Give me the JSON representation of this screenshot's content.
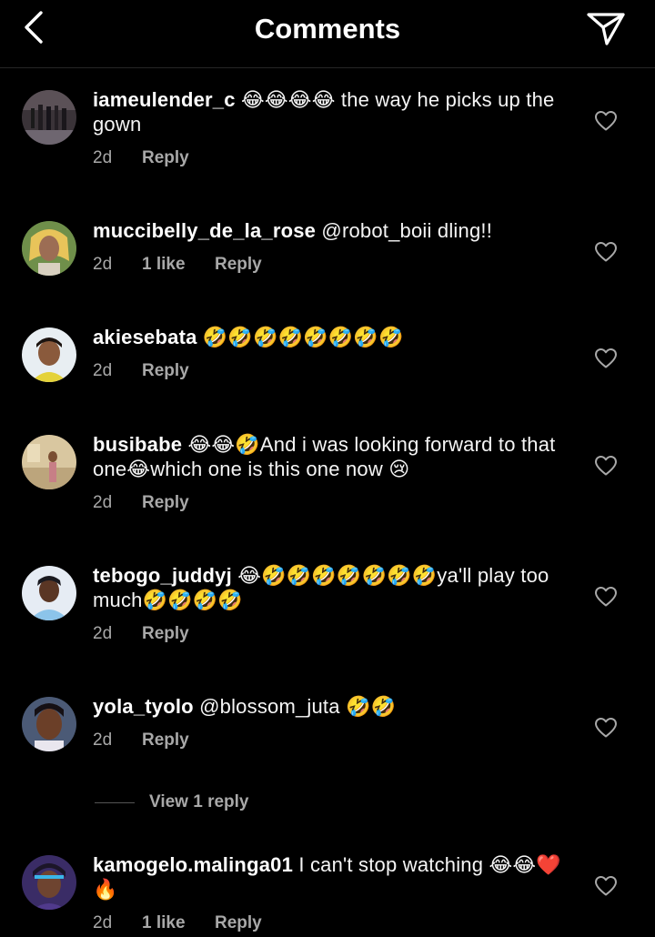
{
  "header": {
    "title": "Comments",
    "back_icon": "chevron-left-icon",
    "share_icon": "paper-plane-icon"
  },
  "comments": [
    {
      "username": "iameulender_c",
      "text": " 😂😂😂😂 the way he picks up the gown",
      "time": "2d",
      "likes": "",
      "reply_label": "Reply"
    },
    {
      "username": "muccibelly_de_la_rose",
      "text": " @robot_boii dling!!",
      "time": "2d",
      "likes": "1 like",
      "reply_label": "Reply"
    },
    {
      "username": "akiesebata",
      "text": " 🤣🤣🤣🤣🤣🤣🤣🤣",
      "time": "2d",
      "likes": "",
      "reply_label": "Reply"
    },
    {
      "username": "busibabe",
      "text": " 😂😂🤣And i was looking forward to that one😂which one is this one now 😢",
      "time": "2d",
      "likes": "",
      "reply_label": "Reply"
    },
    {
      "username": "tebogo_juddyj",
      "text": " 😂🤣🤣🤣🤣🤣🤣🤣ya'll play too much🤣🤣🤣🤣",
      "time": "2d",
      "likes": "",
      "reply_label": "Reply"
    },
    {
      "username": "yola_tyolo",
      "text": " @blossom_juta 🤣🤣",
      "time": "2d",
      "likes": "",
      "reply_label": "Reply"
    },
    {
      "username": "kamogelo.malinga01",
      "text": " I can't stop watching 😂😂❤️🔥",
      "time": "2d",
      "likes": "1 like",
      "reply_label": "Reply"
    }
  ],
  "view_replies": {
    "label": "View 1 reply"
  },
  "colors": {
    "background": "#000000",
    "text": "#f5f5f5",
    "secondary": "#a8a8a8",
    "divider": "#262626"
  }
}
